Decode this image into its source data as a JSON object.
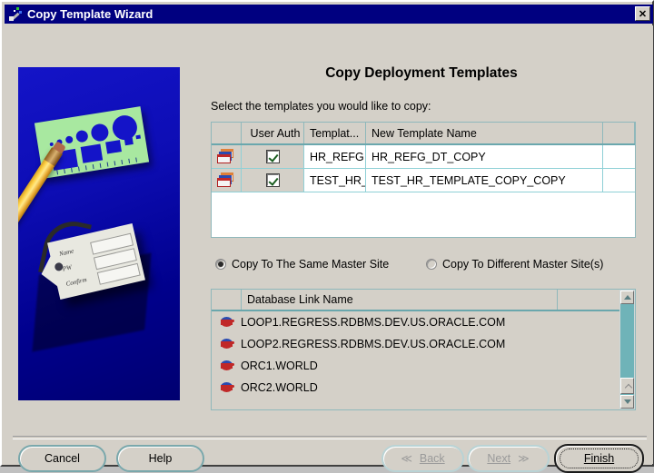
{
  "window": {
    "title": "Copy Template Wizard",
    "title_icon": "wizard-wand-icon",
    "close_label": "✕"
  },
  "header": {
    "page_title": "Copy Deployment Templates",
    "instruction": "Select the templates you would like to copy:"
  },
  "side_graphic": {
    "alt": "template stencil and pencil with password tag",
    "tag_labels": [
      "Name",
      "PW",
      "Confirm"
    ]
  },
  "templates_table": {
    "columns": [
      "",
      "User Auth",
      "Templat...",
      "New Template Name",
      ""
    ],
    "rows": [
      {
        "icon": "template-stack-icon",
        "user_auth_checked": true,
        "template_name": "HR_REFG",
        "new_template_name": "HR_REFG_DT_COPY"
      },
      {
        "icon": "template-stack-icon",
        "user_auth_checked": true,
        "template_name": "TEST_HR_",
        "new_template_name": "TEST_HR_TEMPLATE_COPY_COPY"
      }
    ]
  },
  "copy_mode": {
    "options": [
      {
        "label": "Copy To The Same Master Site",
        "selected": true
      },
      {
        "label": "Copy To Different Master Site(s)",
        "selected": false
      }
    ]
  },
  "dblink_list": {
    "columns": [
      "",
      "Database Link Name",
      ""
    ],
    "rows": [
      {
        "icon": "database-link-icon",
        "name": "LOOP1.REGRESS.RDBMS.DEV.US.ORACLE.COM"
      },
      {
        "icon": "database-link-icon",
        "name": "LOOP2.REGRESS.RDBMS.DEV.US.ORACLE.COM"
      },
      {
        "icon": "database-link-icon",
        "name": "ORC1.WORLD"
      },
      {
        "icon": "database-link-icon",
        "name": "ORC2.WORLD"
      }
    ],
    "scrollbar": {
      "up_arrow": "▲",
      "down_arrow": "▼"
    }
  },
  "footer": {
    "cancel": "Cancel",
    "help": "Help",
    "back": "Back",
    "back_arrow": "≪",
    "next": "Next",
    "next_arrow": "≫",
    "finish": "Finish",
    "back_enabled": false,
    "next_enabled": false
  },
  "colors": {
    "titlebar": "#000080",
    "face": "#d4d0c8",
    "grid_line": "#8fd0d6",
    "accent_teal": "#6aa7ad",
    "scroll_track": "#6fb3b8"
  }
}
